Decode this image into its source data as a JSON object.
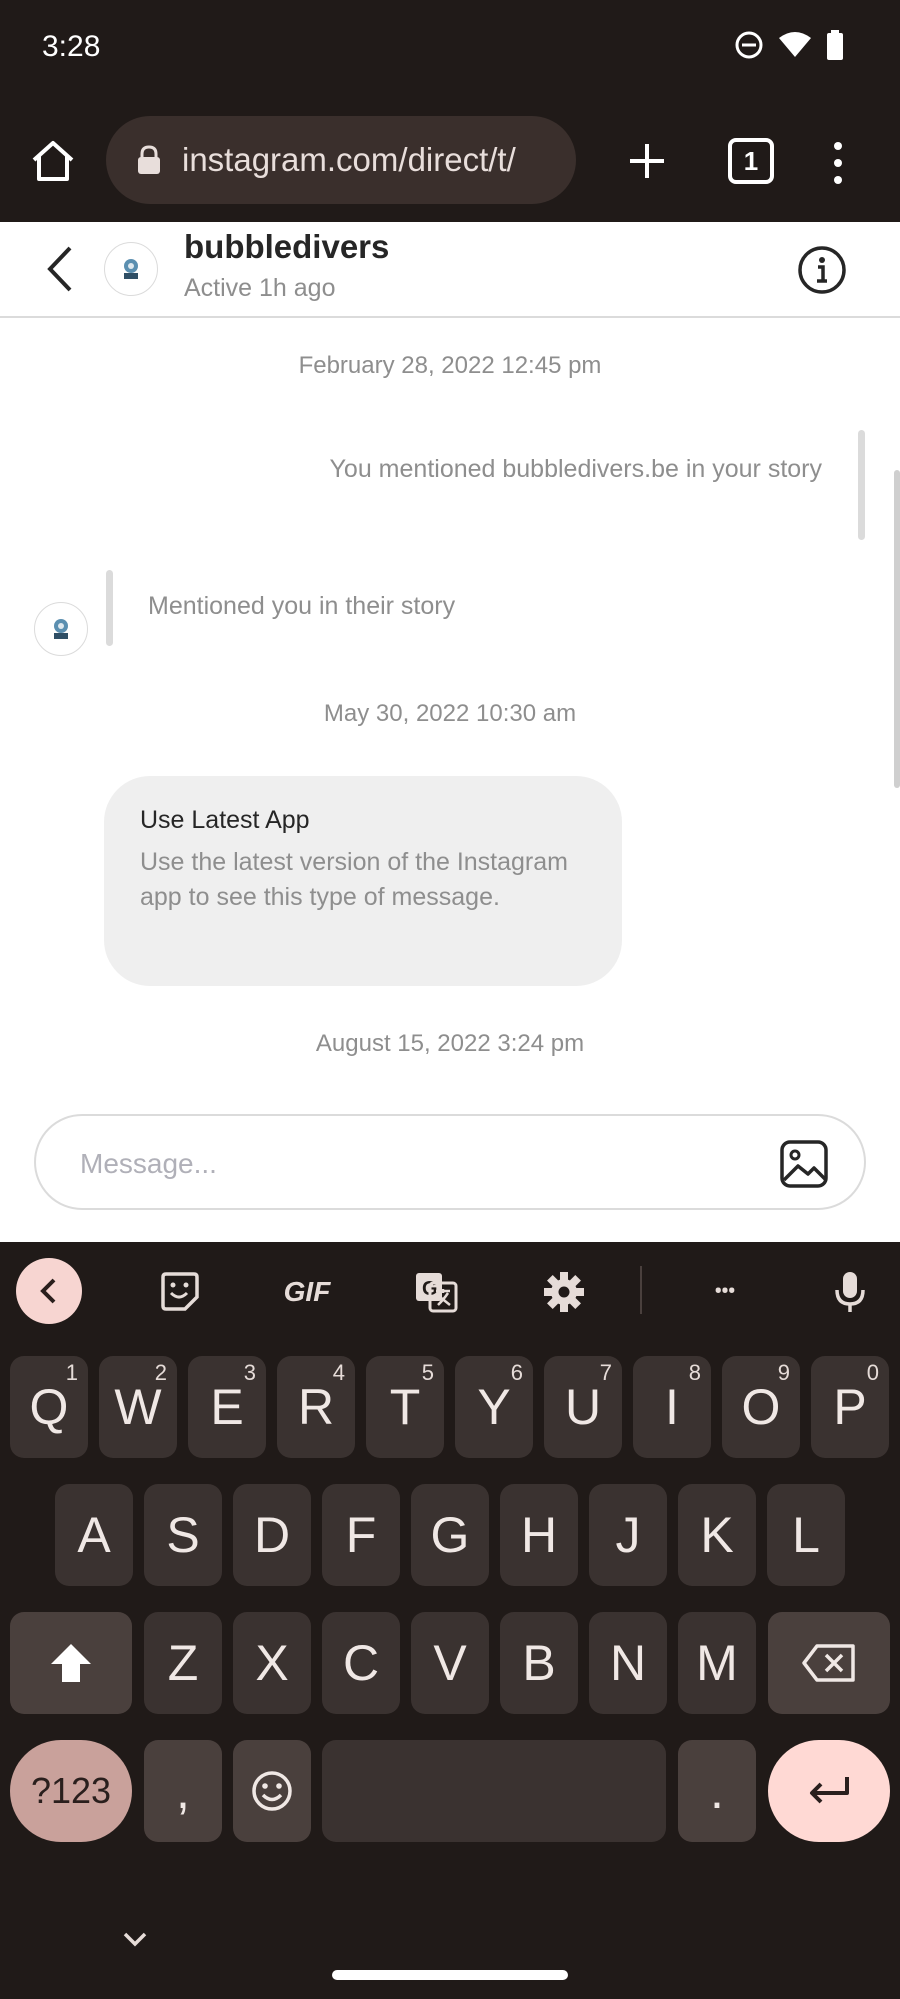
{
  "status_bar": {
    "time": "3:28"
  },
  "browser": {
    "url": "instagram.com/direct/t/",
    "tab_count": "1"
  },
  "chat": {
    "username": "bubbledivers",
    "status": "Active 1h ago",
    "timestamps": [
      "February 28, 2022 12:45 pm",
      "May 30, 2022 10:30 am",
      "August 15, 2022 3:24 pm"
    ],
    "mention_out": "You mentioned bubbledivers.be in your story",
    "mention_in": "Mentioned you in their story",
    "bubble_title": "Use Latest App",
    "bubble_body": "Use the latest version of the Instagram app to see this type of message.",
    "composer_placeholder": "Message..."
  },
  "keyboard": {
    "toolbar": {
      "gif_label": "GIF",
      "more_label": "•••"
    },
    "row1": [
      {
        "label": "Q",
        "hint": "1"
      },
      {
        "label": "W",
        "hint": "2"
      },
      {
        "label": "E",
        "hint": "3"
      },
      {
        "label": "R",
        "hint": "4"
      },
      {
        "label": "T",
        "hint": "5"
      },
      {
        "label": "Y",
        "hint": "6"
      },
      {
        "label": "U",
        "hint": "7"
      },
      {
        "label": "I",
        "hint": "8"
      },
      {
        "label": "O",
        "hint": "9"
      },
      {
        "label": "P",
        "hint": "0"
      }
    ],
    "row2": [
      "A",
      "S",
      "D",
      "F",
      "G",
      "H",
      "J",
      "K",
      "L"
    ],
    "row3": [
      "Z",
      "X",
      "C",
      "V",
      "B",
      "N",
      "M"
    ],
    "symbols_label": "?123",
    "comma_label": ",",
    "period_label": "."
  }
}
